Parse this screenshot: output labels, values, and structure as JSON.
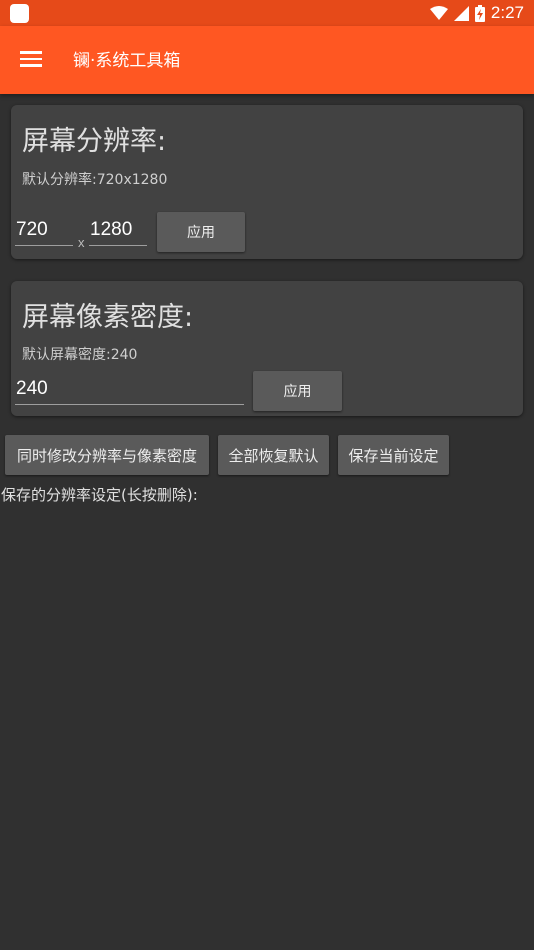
{
  "status_bar": {
    "time": "2:27",
    "icons": [
      "app-icon",
      "wifi-icon",
      "signal-icon",
      "battery-icon"
    ]
  },
  "app_bar": {
    "menu_icon": "menu-icon",
    "title": "镧·系统工具箱"
  },
  "resolution_card": {
    "title": "屏幕分辨率:",
    "default_label": "默认分辨率:720x1280",
    "width_value": "720",
    "separator": "x",
    "height_value": "1280",
    "apply_label": "应用"
  },
  "density_card": {
    "title": "屏幕像素密度:",
    "default_label": "默认屏幕密度:240",
    "density_value": "240",
    "apply_label": "应用"
  },
  "actions": {
    "modify_both": "同时修改分辨率与像素密度",
    "restore_all": "全部恢复默认",
    "save_current": "保存当前设定"
  },
  "saved_settings": {
    "label": "保存的分辨率设定(长按删除):",
    "items": []
  },
  "colors": {
    "app_bar": "#ff5722",
    "status_bar": "#e64a19",
    "background": "#303030",
    "card": "#424242",
    "button": "#5a5a5a"
  }
}
